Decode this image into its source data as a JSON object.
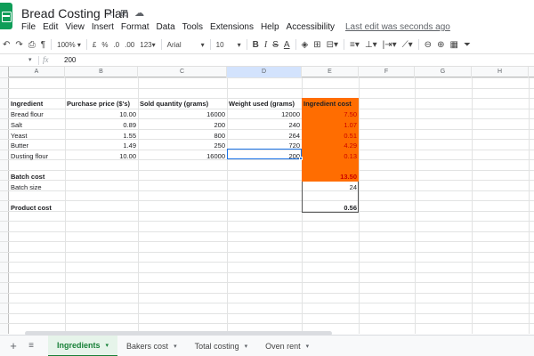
{
  "title": "Bread Costing Plan",
  "menu": [
    "File",
    "Edit",
    "View",
    "Insert",
    "Format",
    "Data",
    "Tools",
    "Extensions",
    "Help",
    "Accessibility"
  ],
  "last_edit": "Last edit was seconds ago",
  "toolbar": {
    "zoom": "100%",
    "currency": "£",
    "percent": "%",
    "dec_decrease": ".0",
    "dec_increase": ".00",
    "number_format": "123",
    "font": "Arial",
    "font_size": "10",
    "bold": "B",
    "italic": "I",
    "strike": "S",
    "text_color": "A"
  },
  "formula_bar": {
    "cell_ref": "",
    "fx": "fx",
    "value": "200"
  },
  "columns": [
    "A",
    "B",
    "C",
    "D",
    "E",
    "F",
    "G",
    "H"
  ],
  "table": {
    "headers": [
      "Ingredient",
      "Purchase price ($'s)",
      "Sold quantity (grams)",
      "Weight used (grams)",
      "Ingredient cost"
    ],
    "rows": [
      [
        "Bread flour",
        "10.00",
        "16000",
        "12000",
        "7.50"
      ],
      [
        "Salt",
        "0.89",
        "200",
        "240",
        "1.07"
      ],
      [
        "Yeast",
        "1.55",
        "800",
        "264",
        "0.51"
      ],
      [
        "Butter",
        "1.49",
        "250",
        "720",
        "4.29"
      ],
      [
        "Dusting flour",
        "10.00",
        "16000",
        "200",
        "0.13"
      ]
    ]
  },
  "summary": {
    "batch_cost_label": "Batch cost",
    "batch_cost_value": "13.50",
    "batch_size_label": "Batch size",
    "batch_size_value": "24",
    "product_cost_label": "Product cost",
    "product_cost_value": "0.56"
  },
  "sheets": [
    "Ingredients",
    "Bakers cost",
    "Total costing",
    "Oven rent"
  ],
  "active_sheet": "Ingredients",
  "colors": {
    "highlight": "#ff6d01",
    "cost_text": "#cc0000",
    "active_tab": "#188038",
    "selection": "#1a73e8"
  }
}
